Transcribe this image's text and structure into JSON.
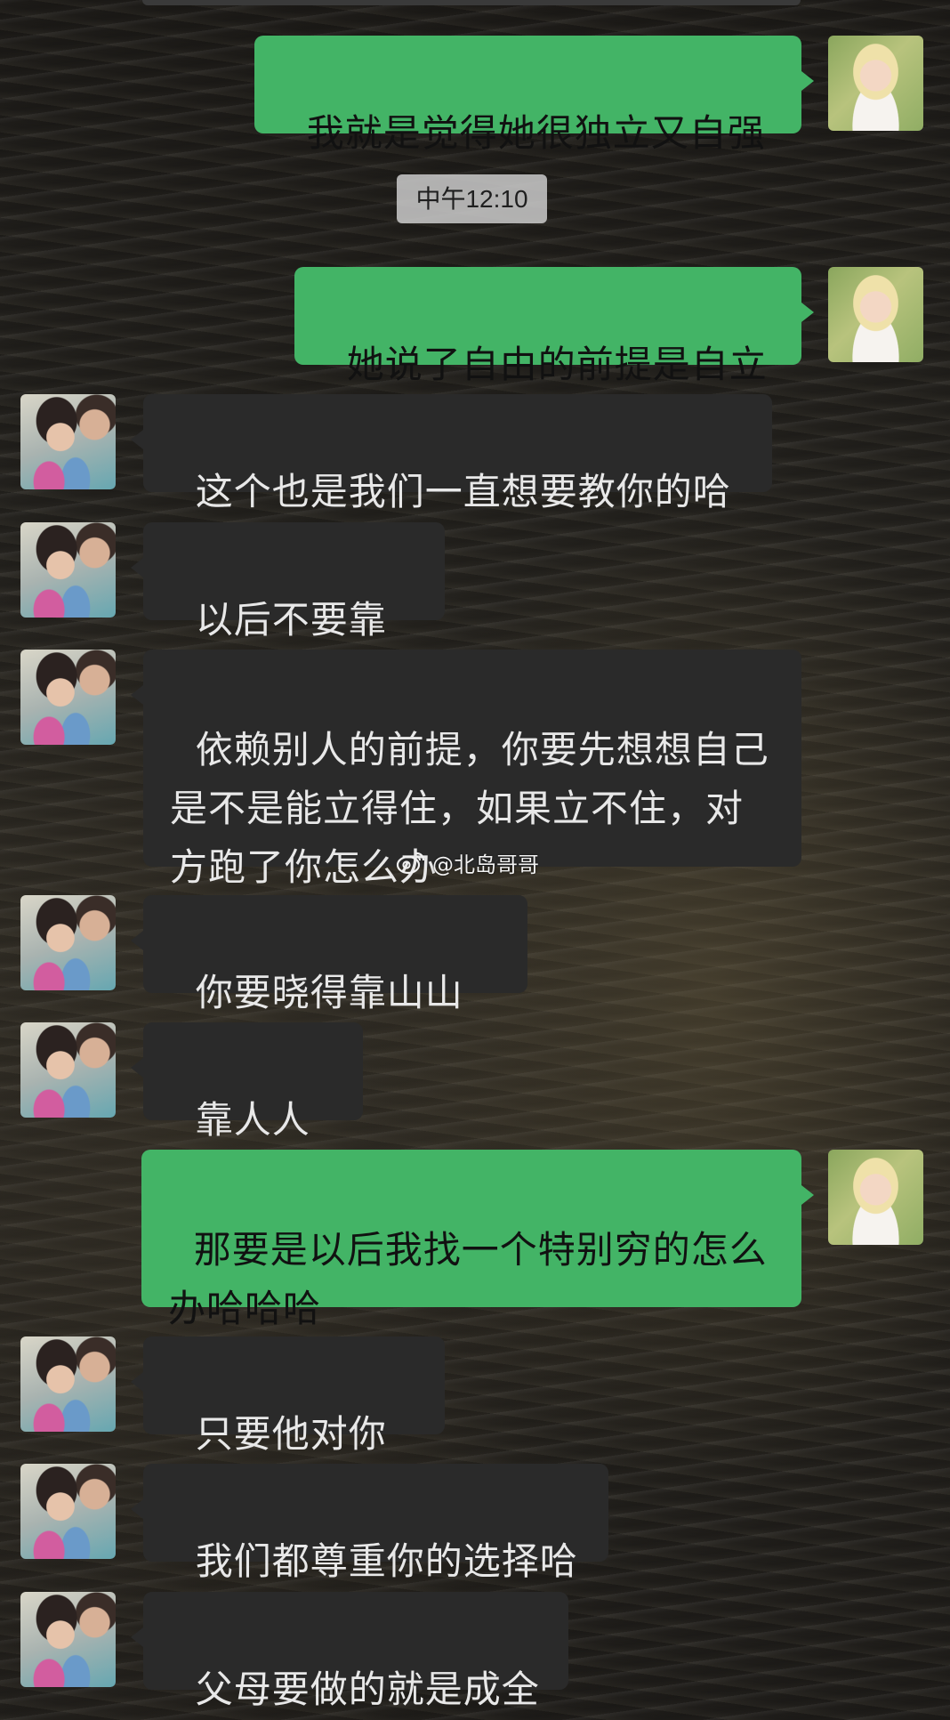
{
  "timestamp": "中午12:10",
  "watermark": "@北岛哥哥",
  "messages": [
    {
      "sender": "self",
      "text": "我就是觉得她很独立又自强"
    },
    {
      "sender": "self",
      "text": "她说了自由的前提是自立"
    },
    {
      "sender": "parent",
      "text": "这个也是我们一直想要教你的哈"
    },
    {
      "sender": "parent",
      "text": "以后不要靠谁"
    },
    {
      "sender": "parent",
      "text": "依赖别人的前提，你要先想想自己是不是能立得住，如果立不住，对方跑了你怎么办"
    },
    {
      "sender": "parent",
      "text": "你要晓得靠山山倒"
    },
    {
      "sender": "parent",
      "text": "靠人人跑"
    },
    {
      "sender": "self",
      "text": "那要是以后我找一个特别穷的怎么办哈哈哈"
    },
    {
      "sender": "parent",
      "text": "只要他对你好"
    },
    {
      "sender": "parent",
      "text": "我们都尊重你的选择哈"
    },
    {
      "sender": "parent",
      "text": "父母要做的就是成全"
    }
  ],
  "colors": {
    "self_bubble": "#43b466",
    "parent_bubble": "#2a2a2a",
    "timestamp_bg": "#d2d2d2"
  },
  "icons": {
    "self_avatar": "girl-avatar-icon",
    "parent_avatar": "parents-avatar-icon",
    "watermark_logo": "weibo-icon"
  }
}
